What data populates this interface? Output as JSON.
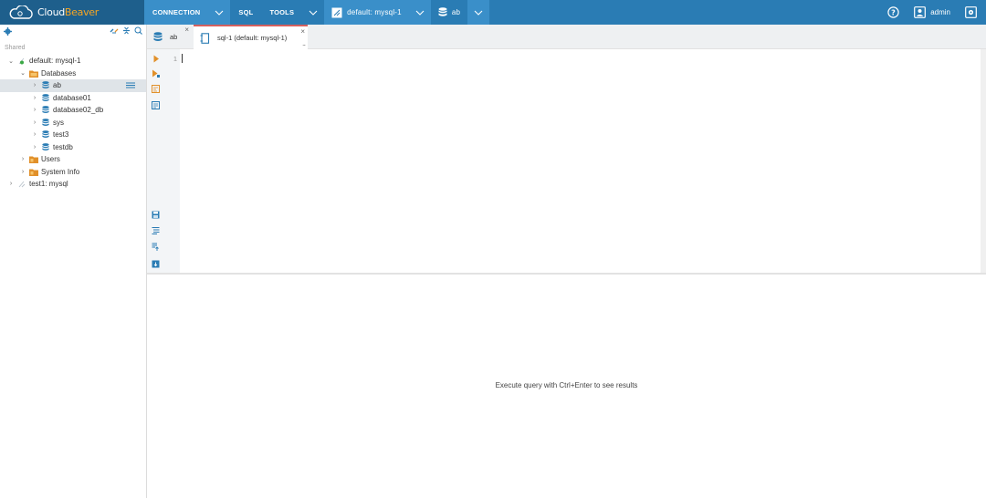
{
  "app": {
    "logo_part1": "Cloud",
    "logo_part2": "Beaver"
  },
  "topbar": {
    "menu": {
      "connection": "CONNECTION",
      "sql": "SQL",
      "tools": "TOOLS"
    },
    "context": {
      "connection": "default: mysql-1",
      "database": "ab"
    },
    "user": "admin",
    "icons": [
      "cloud-logo-icon",
      "chevron-down-icon",
      "connection-icon",
      "database-icon",
      "help-icon",
      "user-icon",
      "settings-icon"
    ]
  },
  "navigator": {
    "section_label": "Shared",
    "tree": [
      {
        "label": "default: mysql-1",
        "level": 0,
        "expanded": true,
        "icon": "connection-icon",
        "status": "connected"
      },
      {
        "label": "Databases",
        "level": 1,
        "expanded": true,
        "icon": "folder-icon"
      },
      {
        "label": "ab",
        "level": 2,
        "expanded": false,
        "icon": "database-icon",
        "selected": true
      },
      {
        "label": "database01",
        "level": 2,
        "expanded": false,
        "icon": "database-icon"
      },
      {
        "label": "database02_db",
        "level": 2,
        "expanded": false,
        "icon": "database-icon"
      },
      {
        "label": "sys",
        "level": 2,
        "expanded": false,
        "icon": "database-icon"
      },
      {
        "label": "test3",
        "level": 2,
        "expanded": false,
        "icon": "database-icon"
      },
      {
        "label": "testdb",
        "level": 2,
        "expanded": false,
        "icon": "database-icon"
      },
      {
        "label": "Users",
        "level": 1,
        "expanded": false,
        "icon": "folder-icon"
      },
      {
        "label": "System Info",
        "level": 1,
        "expanded": false,
        "icon": "folder-icon"
      },
      {
        "label": "test1: mysql",
        "level": 0,
        "expanded": false,
        "icon": "connection-icon",
        "status": "disconnected"
      }
    ]
  },
  "editor": {
    "tabs": [
      {
        "label": "ab",
        "active": false
      },
      {
        "label": "sql-1 (default: mysql-1)",
        "active": true
      }
    ],
    "line_numbers": [
      "1"
    ],
    "colors": {
      "active_tab_accent": "#d4605f",
      "accent": "#2a7cb4"
    }
  },
  "results": {
    "empty_message": "Execute query with Ctrl+Enter to see results"
  }
}
